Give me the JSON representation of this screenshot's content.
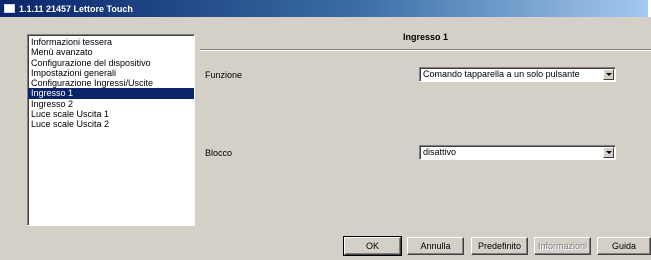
{
  "window": {
    "title": "1.1.11 21457 Lettore Touch"
  },
  "sidebar": {
    "items": [
      {
        "label": "Informazioni tessera",
        "selected": false
      },
      {
        "label": "Menù avanzato",
        "selected": false
      },
      {
        "label": "Configurazione del dispositivo",
        "selected": false
      },
      {
        "label": "Impostazioni generali",
        "selected": false
      },
      {
        "label": "Configurazione Ingressi/Uscite",
        "selected": false
      },
      {
        "label": "Ingresso 1",
        "selected": true
      },
      {
        "label": "Ingresso 2",
        "selected": false
      },
      {
        "label": "Luce scale Uscita 1",
        "selected": false
      },
      {
        "label": "Luce scale Uscita 2",
        "selected": false
      }
    ]
  },
  "panel": {
    "title": "Ingresso 1",
    "funzione": {
      "label": "Funzione",
      "value": "Comando tapparella a un solo pulsante"
    },
    "blocco": {
      "label": "Blocco",
      "value": "disattivo"
    }
  },
  "buttons": {
    "ok": "OK",
    "annulla": "Annulla",
    "predefinito": "Predefinito",
    "informazioni": "Informazioni",
    "guida": "Guida"
  },
  "colors": {
    "selection": "#0a246a",
    "face": "#d4d0c8",
    "titlebar_start": "#0a246a",
    "titlebar_end": "#a6caf0"
  }
}
